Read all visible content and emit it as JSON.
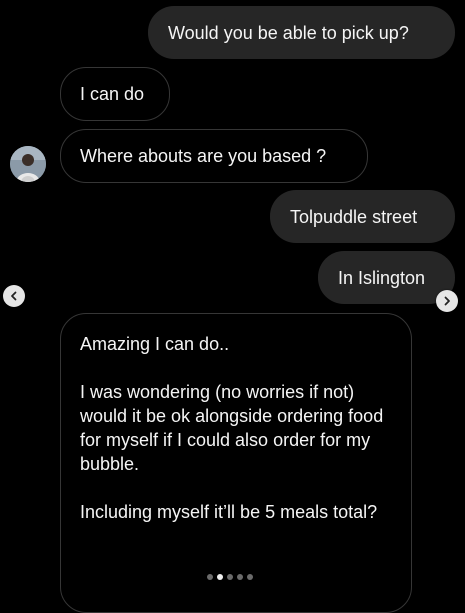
{
  "messages": [
    {
      "direction": "sent",
      "text": "Would you be able to pick up?"
    },
    {
      "direction": "received",
      "text": "I can do"
    },
    {
      "direction": "received",
      "text": "Where abouts are you based ?"
    },
    {
      "direction": "sent",
      "text": "Tolpuddle street"
    },
    {
      "direction": "sent",
      "text": "In Islington"
    },
    {
      "direction": "received",
      "paragraphs": [
        "Amazing I can do..",
        "I was wondering (no worries if not) would it be ok alongside ordering food for myself if I could also order for my bubble.",
        "Including myself it’ll be 5 meals total?"
      ]
    }
  ],
  "carousel": {
    "prev_icon": "chevron-left-icon",
    "next_icon": "chevron-right-icon",
    "page_count": 5,
    "active_page": 2
  },
  "colors": {
    "background": "#000000",
    "sent_bubble": "#262626",
    "received_border": "#363636",
    "text": "#f5f5f5"
  }
}
